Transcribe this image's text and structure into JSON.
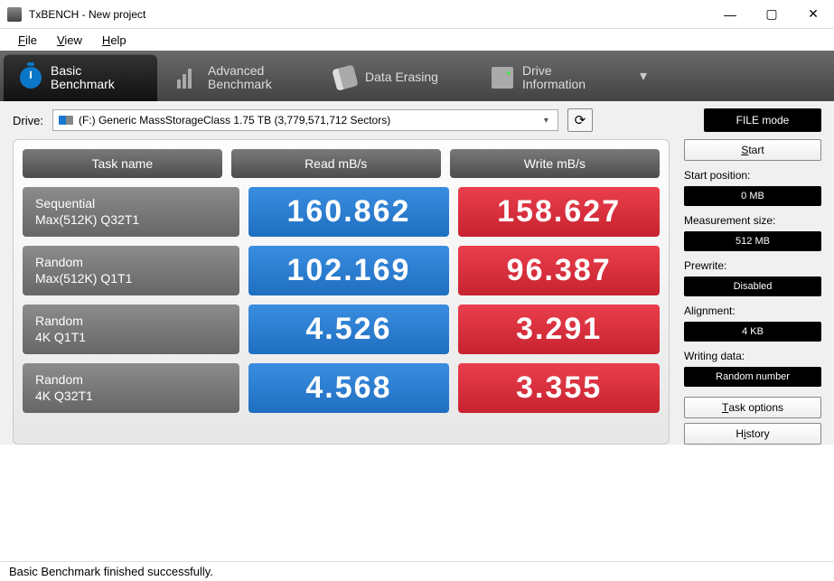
{
  "window": {
    "title": "TxBENCH - New project"
  },
  "menu": {
    "file": "File",
    "view": "View",
    "help": "Help"
  },
  "tabs": [
    {
      "line1": "Basic",
      "line2": "Benchmark",
      "active": true
    },
    {
      "line1": "Advanced",
      "line2": "Benchmark",
      "active": false
    },
    {
      "line1": "Data Erasing",
      "line2": "",
      "active": false
    },
    {
      "line1": "Drive",
      "line2": "Information",
      "active": false
    }
  ],
  "drive": {
    "label": "Drive:",
    "selected": "(F:) Generic MassStorageClass   1.75 TB (3,779,571,712 Sectors)",
    "mode_button": "FILE mode"
  },
  "headers": {
    "task": "Task name",
    "read": "Read mB/s",
    "write": "Write mB/s"
  },
  "results": [
    {
      "name1": "Sequential",
      "name2": "Max(512K) Q32T1",
      "read": "160.862",
      "write": "158.627"
    },
    {
      "name1": "Random",
      "name2": "Max(512K) Q1T1",
      "read": "102.169",
      "write": "96.387"
    },
    {
      "name1": "Random",
      "name2": "4K Q1T1",
      "read": "4.526",
      "write": "3.291"
    },
    {
      "name1": "Random",
      "name2": "4K Q32T1",
      "read": "4.568",
      "write": "3.355"
    }
  ],
  "side": {
    "start": "Start",
    "start_position_label": "Start position:",
    "start_position": "0 MB",
    "meas_size_label": "Measurement size:",
    "meas_size": "512 MB",
    "prewrite_label": "Prewrite:",
    "prewrite": "Disabled",
    "alignment_label": "Alignment:",
    "alignment": "4 KB",
    "writing_label": "Writing data:",
    "writing": "Random number",
    "task_options": "Task options",
    "history": "History"
  },
  "status": "Basic Benchmark finished successfully."
}
